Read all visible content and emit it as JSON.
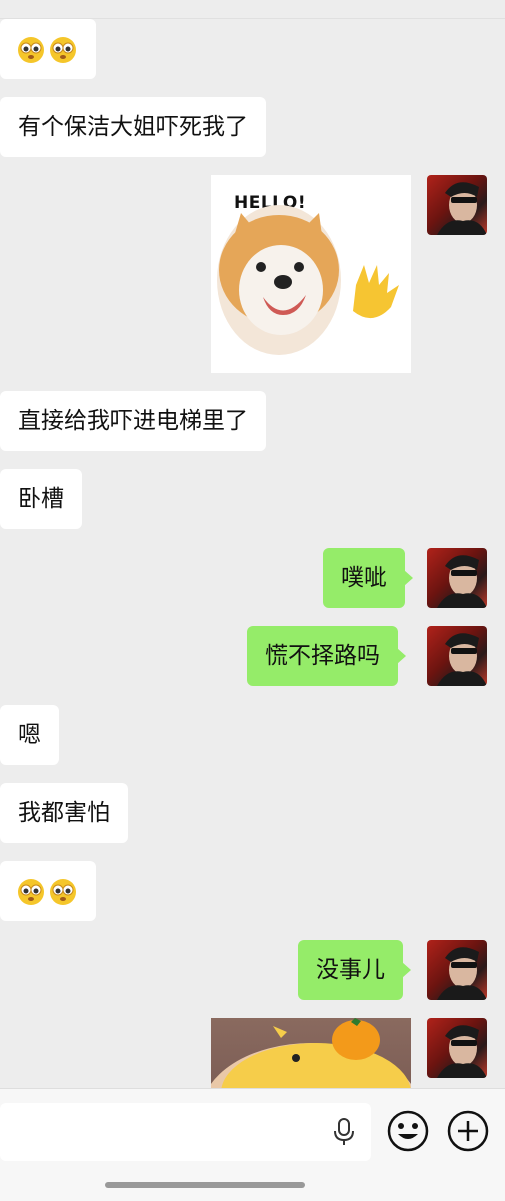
{
  "messages": [
    {
      "side": "left",
      "type": "emoji",
      "emoji": [
        "eyes-emoji",
        "eyes-emoji"
      ]
    },
    {
      "side": "left",
      "type": "text",
      "text": "有个保洁大姐吓死我了"
    },
    {
      "side": "right",
      "type": "sticker",
      "text": "HELLO!"
    },
    {
      "side": "left",
      "type": "text",
      "text": "直接给我吓进电梯里了"
    },
    {
      "side": "left",
      "type": "text",
      "text": "卧槽"
    },
    {
      "side": "right",
      "type": "text",
      "text": "噗呲"
    },
    {
      "side": "right",
      "type": "text",
      "text": "慌不择路吗"
    },
    {
      "side": "left",
      "type": "text",
      "text": "嗯"
    },
    {
      "side": "left",
      "type": "text",
      "text": "我都害怕"
    },
    {
      "side": "left",
      "type": "emoji",
      "emoji": [
        "eyes-emoji",
        "eyes-emoji"
      ]
    },
    {
      "side": "right",
      "type": "text",
      "text": "没事儿"
    },
    {
      "side": "right",
      "type": "image"
    }
  ],
  "colors": {
    "background": "#ededed",
    "right_bubble": "#95ec69",
    "left_bubble": "#ffffff"
  },
  "input_bar": {
    "icons": [
      "microphone-icon",
      "emoji-smile-icon",
      "plus-icon"
    ]
  }
}
